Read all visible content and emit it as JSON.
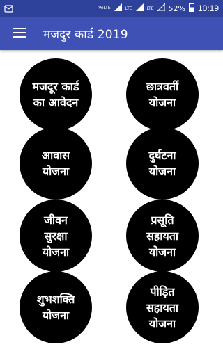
{
  "status_bar": {
    "volte": "VoLTE",
    "lte1": "LTE",
    "lte2": "LTE",
    "battery_percent": "52%",
    "time": "10:19"
  },
  "app_bar": {
    "title": "मजदुर कार्ड 2019"
  },
  "menu_buttons": [
    {
      "label": "मजदूर कार्ड\nका आवेदन"
    },
    {
      "label": "छात्रवर्ती\nयोजना"
    },
    {
      "label": "आवास\nयोजना"
    },
    {
      "label": "दुर्घटना\nयोजना"
    },
    {
      "label": "जीवन\nसुरक्षा\nयोजना"
    },
    {
      "label": "प्रसूति\nसहायता\nयोजना"
    },
    {
      "label": "शुभशक्ति\nयोजना"
    },
    {
      "label": "पीड़ित\nसहायता\nयोजना"
    }
  ],
  "colors": {
    "status_bar": "#2f429b",
    "app_bar": "#3f51b5",
    "circle": "#000000",
    "text": "#ffffff"
  }
}
